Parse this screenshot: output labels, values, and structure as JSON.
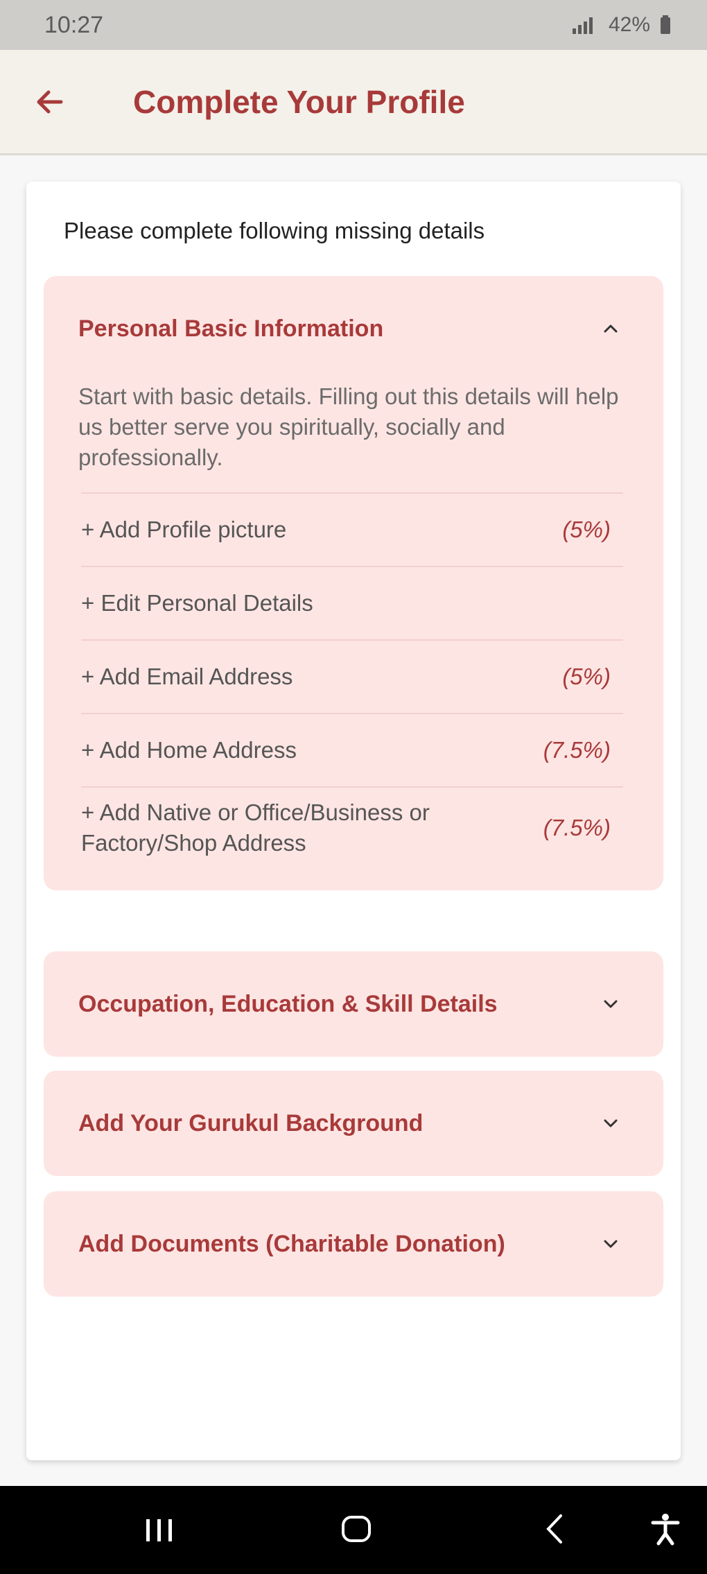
{
  "status_bar": {
    "time": "10:27",
    "right_text": "42%"
  },
  "app_bar": {
    "title": "Complete Your Profile"
  },
  "intro_text": "Please complete following missing details",
  "sections": [
    {
      "title": "Personal Basic Information",
      "expanded": true,
      "description": "Start with basic details. Filling out this details will help us better serve you spiritually, socially and professionally.",
      "tasks": [
        {
          "label": "+ Add Profile picture",
          "percent": "(5%)"
        },
        {
          "label": "+ Edit Personal Details",
          "percent": ""
        },
        {
          "label": "+ Add Email Address",
          "percent": "(5%)"
        },
        {
          "label": "+ Add Home Address",
          "percent": "(7.5%)"
        },
        {
          "label": "+ Add Native or Office/Business or Factory/Shop Address",
          "percent": "(7.5%)"
        }
      ]
    },
    {
      "title": "Occupation, Education & Skill Details",
      "expanded": false
    },
    {
      "title": "Add Your Gurukul Background",
      "expanded": false
    },
    {
      "title": "Add Documents (Charitable Donation)",
      "expanded": false
    }
  ],
  "icons": {
    "back": "arrow-left-icon",
    "collapse": "chevron-up-icon",
    "expand": "chevron-down-icon",
    "nav_recents": "recents-icon",
    "nav_home": "home-icon",
    "nav_back": "back-icon",
    "nav_accessibility": "accessibility-icon"
  },
  "colors": {
    "accent": "#a83a3a",
    "panel_bg": "#fde5e3",
    "app_bar_bg": "#f3f1ea"
  }
}
